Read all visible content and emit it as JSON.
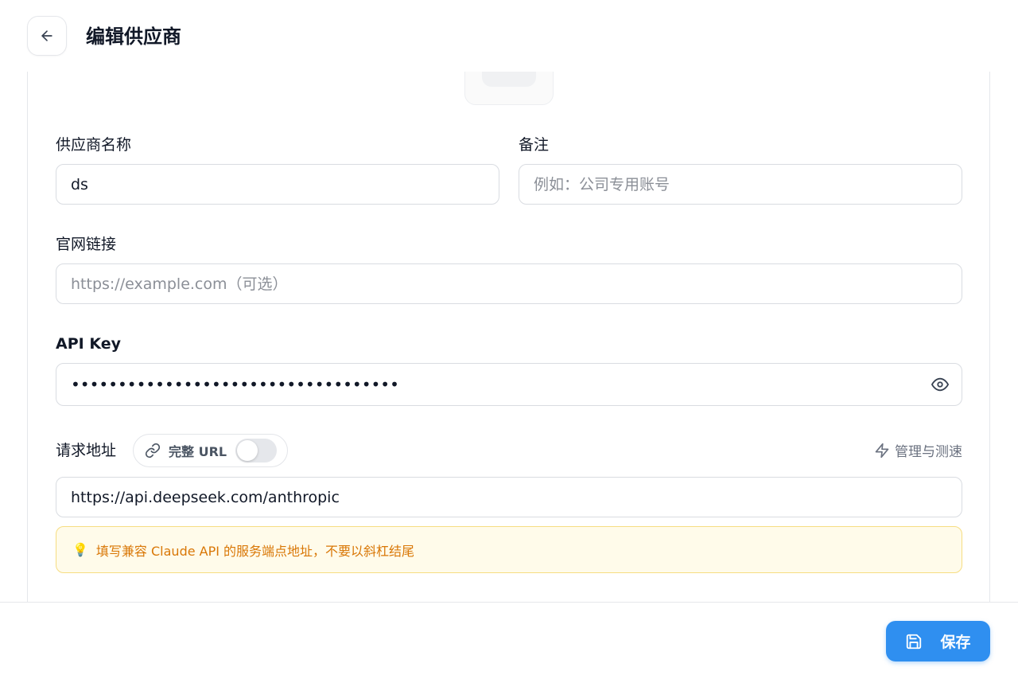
{
  "header": {
    "title": "编辑供应商",
    "back_icon": "arrow-left-icon"
  },
  "form": {
    "name": {
      "label": "供应商名称",
      "value": "ds"
    },
    "notes": {
      "label": "备注",
      "placeholder": "例如：公司专用账号"
    },
    "website": {
      "label": "官网链接",
      "placeholder": "https://example.com（可选）"
    },
    "api_key": {
      "label": "API Key",
      "masked_value": "•••••••••••••••••••••••••••••••••••"
    },
    "endpoint": {
      "label": "请求地址",
      "full_url_label": "完整 URL",
      "full_url_enabled": false,
      "manage_label": "管理与测速",
      "value": "https://api.deepseek.com/anthropic",
      "hint": "填写兼容 Claude API 的服务端点地址，不要以斜杠结尾"
    }
  },
  "footer": {
    "save_label": "保存"
  },
  "colors": {
    "accent": "#2f8ff0",
    "hint_bg": "#fffbea",
    "hint_text": "#d97706"
  }
}
